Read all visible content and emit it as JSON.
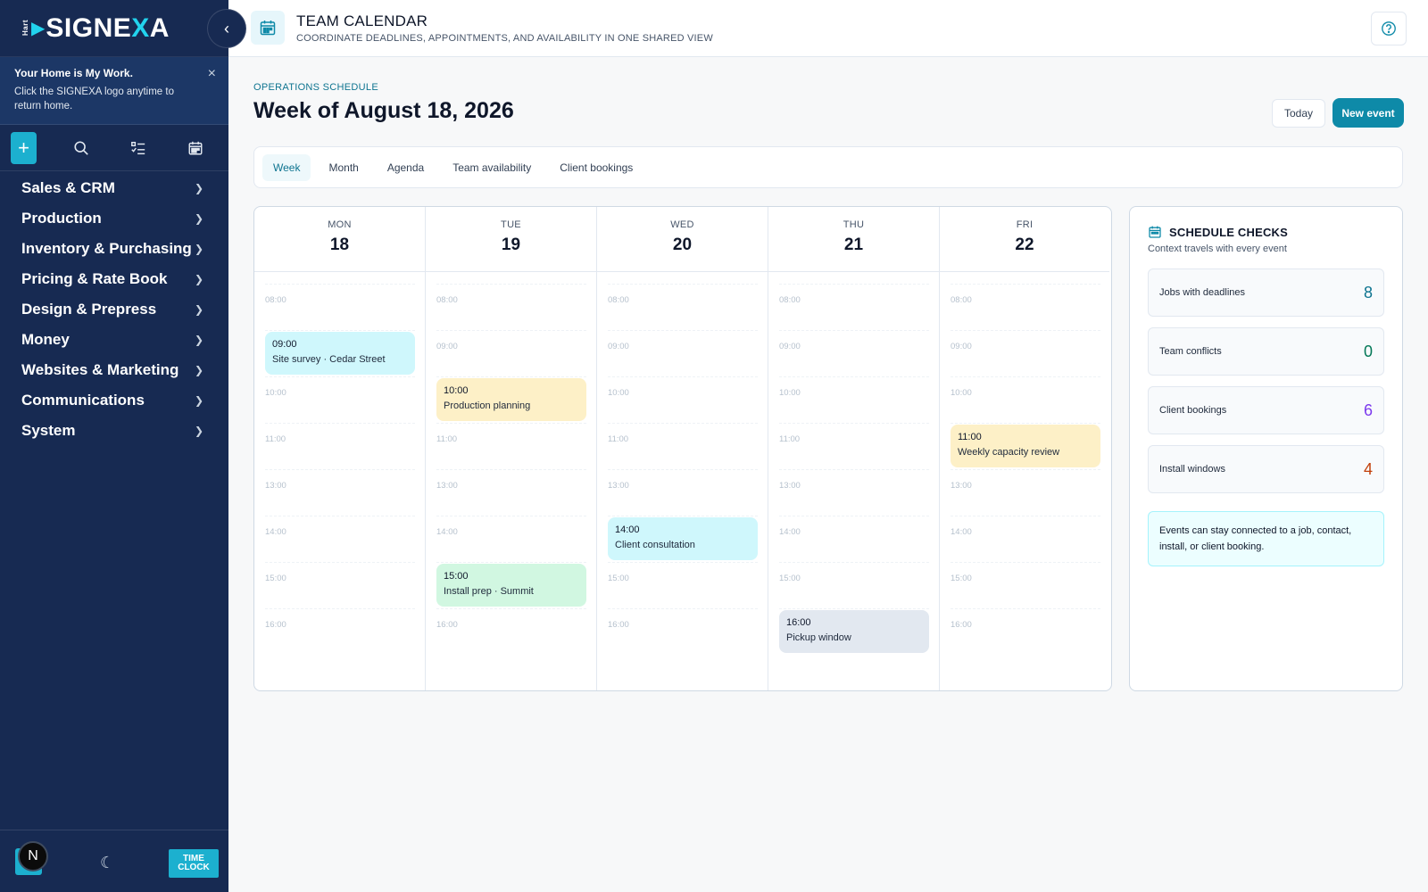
{
  "brand": {
    "small": "Hart",
    "name_a": "SIGNE",
    "name_x": "X",
    "name_b": "A"
  },
  "notice": {
    "title": "Your Home is My Work.",
    "body": "Click the SIGNEXA logo anytime to return home.",
    "close": "×"
  },
  "quick_actions": [
    {
      "icon": "plus-icon"
    },
    {
      "icon": "search-icon"
    },
    {
      "icon": "checklist-icon"
    },
    {
      "icon": "calendar-icon"
    }
  ],
  "nav": [
    {
      "label": "Sales & CRM"
    },
    {
      "label": "Production"
    },
    {
      "label": "Inventory & Purchasing"
    },
    {
      "label": "Pricing & Rate Book"
    },
    {
      "label": "Design & Prepress"
    },
    {
      "label": "Money"
    },
    {
      "label": "Websites & Marketing"
    },
    {
      "label": "Communications"
    },
    {
      "label": "System"
    }
  ],
  "footer": {
    "avatar_initial": "N",
    "time_clock_line1": "TIME",
    "time_clock_line2": "CLOCK"
  },
  "header": {
    "title": "TEAM CALENDAR",
    "subtitle": "COORDINATE DEADLINES, APPOINTMENTS, AND AVAILABILITY IN ONE SHARED VIEW"
  },
  "main": {
    "eyebrow": "OPERATIONS SCHEDULE",
    "title": "Week of August 18, 2026",
    "today_label": "Today",
    "new_event_label": "New event",
    "tabs": [
      {
        "label": "Week",
        "active": true
      },
      {
        "label": "Month"
      },
      {
        "label": "Agenda"
      },
      {
        "label": "Team availability"
      },
      {
        "label": "Client bookings"
      }
    ]
  },
  "calendar": {
    "days": [
      {
        "name": "MON",
        "num": "18",
        "slots": [
          "08:00",
          "",
          "10:00",
          "11:00",
          "13:00",
          "14:00",
          "15:00",
          "16:00"
        ],
        "events": [
          {
            "time": "09:00",
            "title": "Site survey · Cedar Street",
            "color": "cyan",
            "slot": 1
          }
        ]
      },
      {
        "name": "TUE",
        "num": "19",
        "slots": [
          "08:00",
          "09:00",
          "",
          "11:00",
          "13:00",
          "14:00",
          "",
          "16:00"
        ],
        "events": [
          {
            "time": "10:00",
            "title": "Production planning",
            "color": "amber",
            "slot": 2
          },
          {
            "time": "15:00",
            "title": "Install prep · Summit",
            "color": "green",
            "slot": 6
          }
        ]
      },
      {
        "name": "WED",
        "num": "20",
        "slots": [
          "08:00",
          "09:00",
          "10:00",
          "11:00",
          "13:00",
          "",
          "15:00",
          "16:00"
        ],
        "events": [
          {
            "time": "14:00",
            "title": "Client consultation",
            "color": "cyan",
            "slot": 5
          }
        ]
      },
      {
        "name": "THU",
        "num": "21",
        "slots": [
          "08:00",
          "09:00",
          "10:00",
          "11:00",
          "13:00",
          "14:00",
          "15:00",
          ""
        ],
        "events": [
          {
            "time": "16:00",
            "title": "Pickup window",
            "color": "slate",
            "slot": 7
          }
        ]
      },
      {
        "name": "FRI",
        "num": "22",
        "slots": [
          "08:00",
          "09:00",
          "10:00",
          "",
          "13:00",
          "14:00",
          "15:00",
          "16:00"
        ],
        "events": [
          {
            "time": "11:00",
            "title": "Weekly capacity review",
            "color": "amber",
            "slot": 3
          }
        ]
      }
    ]
  },
  "checks": {
    "title": "SCHEDULE CHECKS",
    "subtitle": "Context travels with every event",
    "metrics": [
      {
        "label": "Jobs with deadlines",
        "value": "8",
        "color": "#0e7490"
      },
      {
        "label": "Team conflicts",
        "value": "0",
        "color": "#047857"
      },
      {
        "label": "Client bookings",
        "value": "6",
        "color": "#7c3aed"
      },
      {
        "label": "Install windows",
        "value": "4",
        "color": "#c2410c"
      }
    ],
    "note": "Events can stay connected to a job, contact, install, or client booking."
  },
  "colors": {
    "sidebar": "#172a52",
    "accent": "#1cb0cf",
    "primary_button": "#0e8aa8"
  }
}
